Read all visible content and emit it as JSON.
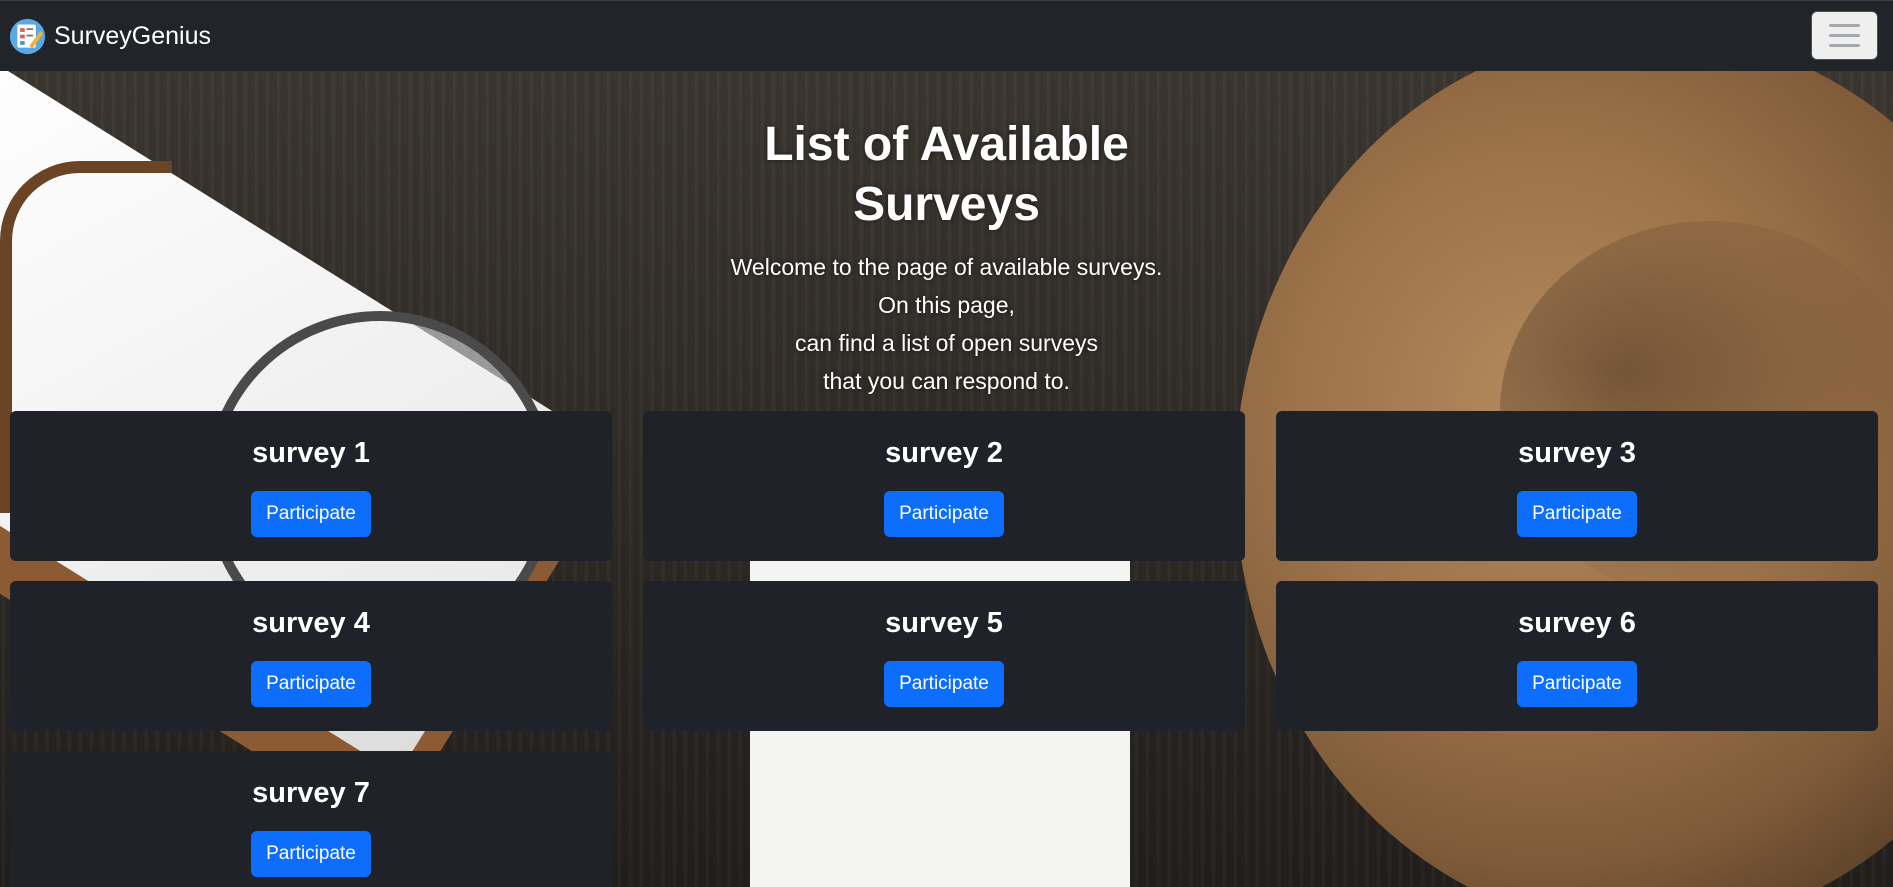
{
  "navbar": {
    "brand_name": "SurveyGenius",
    "logo_icon": "survey-logo-icon",
    "menu_icon": "hamburger-icon"
  },
  "header": {
    "title": "List of Available Surveys",
    "intro_lines": [
      "Welcome to the page of available surveys.",
      "On this page,",
      "can find a list of open surveys",
      "that you can respond to."
    ]
  },
  "surveys": [
    {
      "title": "survey 1",
      "button_label": "Participate"
    },
    {
      "title": "survey 2",
      "button_label": "Participate"
    },
    {
      "title": "survey 3",
      "button_label": "Participate"
    },
    {
      "title": "survey 4",
      "button_label": "Participate"
    },
    {
      "title": "survey 5",
      "button_label": "Participate"
    },
    {
      "title": "survey 6",
      "button_label": "Participate"
    },
    {
      "title": "survey 7",
      "button_label": "Participate"
    }
  ],
  "colors": {
    "navbar_bg": "#212529",
    "card_bg": "#1f2228",
    "button_primary": "#0d6efd",
    "text": "#ffffff"
  }
}
